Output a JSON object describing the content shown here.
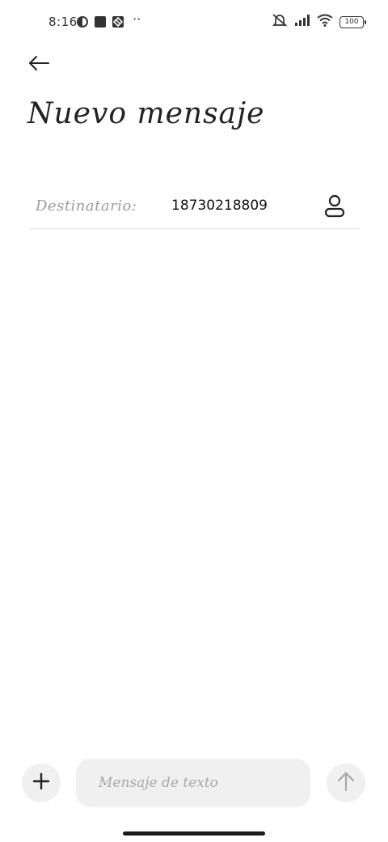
{
  "status_bar": {
    "time": "8:16",
    "dots": "··",
    "battery": "100",
    "icons": [
      "circle-status-icon",
      "square-status-icon",
      "grid-status-icon",
      "mute-icon",
      "signal-icon",
      "wifi-icon",
      "battery-icon"
    ]
  },
  "header": {
    "back_icon": "arrow-left-icon",
    "title": "Nuevo mensaje"
  },
  "recipient": {
    "label": "Destinatario:",
    "value": "18730218809",
    "contact_icon": "person-icon"
  },
  "compose": {
    "attach_icon": "plus-icon",
    "placeholder": "Mensaje de texto",
    "send_icon": "arrow-up-icon"
  }
}
